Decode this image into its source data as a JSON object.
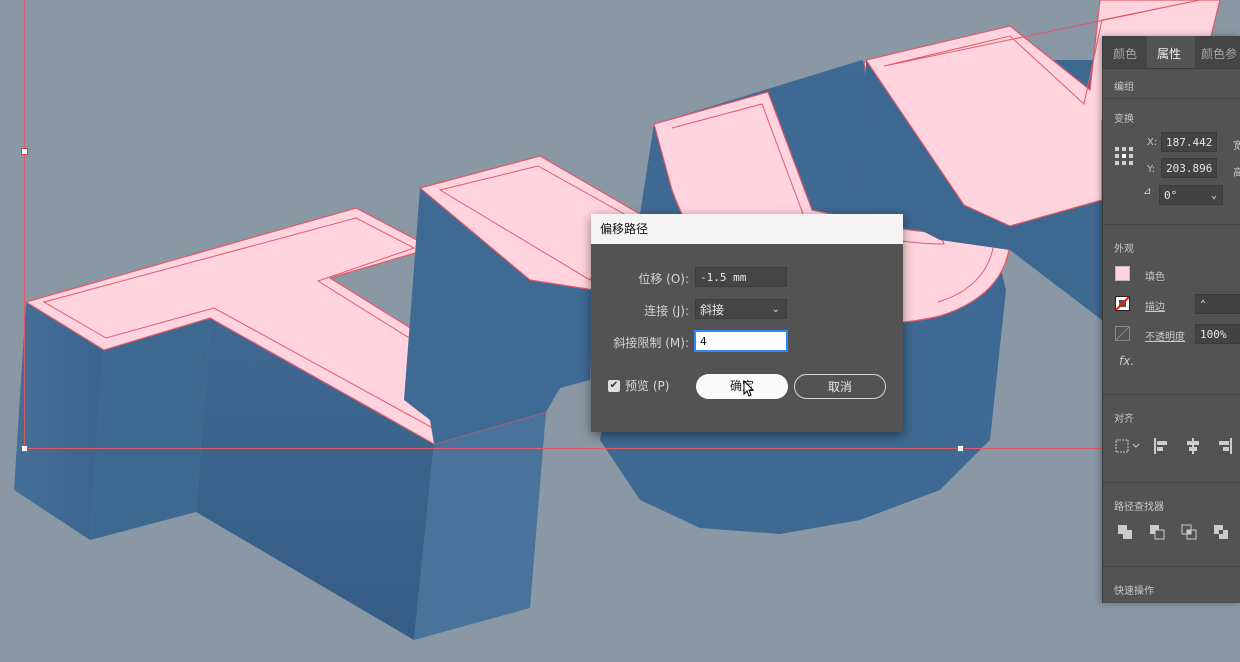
{
  "dialog": {
    "title": "偏移路径",
    "offset_label": "位移 (O):",
    "offset_value": "-1.5 mm",
    "joins_label": "连接 (J):",
    "joins_value": "斜接",
    "miter_label": "斜接限制 (M):",
    "miter_value": "4",
    "preview_label": "预览 (P)",
    "ok_label": "确定",
    "cancel_label": "取消"
  },
  "panel": {
    "tabs": [
      "颜色",
      "属性",
      "颜色参"
    ],
    "group_label": "编组",
    "transform_label": "变换",
    "x_label": "X:",
    "x_value": "187.442",
    "y_label": "Y:",
    "y_value": "203.896",
    "w_label_partial": "宽",
    "h_label_partial": "高",
    "angle_value": "0°",
    "appearance_label": "外观",
    "fill_label": "填色",
    "stroke_label": "描边",
    "opacity_label": "不透明度",
    "opacity_value": "100%",
    "fx_label": "fx.",
    "align_label": "对齐",
    "pathfinder_label": "路径查找器",
    "quick_actions_label": "快速操作"
  },
  "colors": {
    "canvas": "#8a98a6",
    "letter_top": "#ffd4de",
    "letter_side": "#3f6b92",
    "outline": "#e05a6a",
    "dialog_bg": "#535353",
    "accent": "#2f86ff"
  }
}
